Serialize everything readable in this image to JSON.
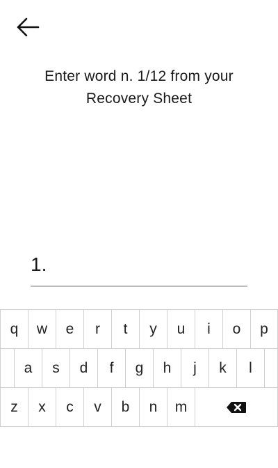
{
  "header": {
    "back_icon": "arrow-left-icon"
  },
  "prompt": {
    "line1": "Enter word n. 1/12 from your",
    "line2": "Recovery Sheet"
  },
  "word_field": {
    "index_label": "1.",
    "value": ""
  },
  "keyboard": {
    "rows": [
      [
        "q",
        "w",
        "e",
        "r",
        "t",
        "y",
        "u",
        "i",
        "o",
        "p"
      ],
      [
        "a",
        "s",
        "d",
        "f",
        "g",
        "h",
        "j",
        "k",
        "l"
      ],
      [
        "z",
        "x",
        "c",
        "v",
        "b",
        "n",
        "m"
      ]
    ],
    "backspace_icon": "backspace-icon"
  }
}
